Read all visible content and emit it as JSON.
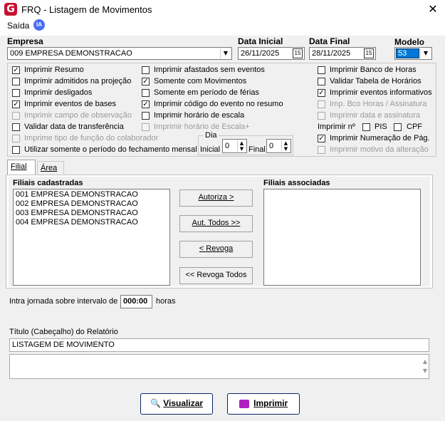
{
  "window": {
    "logo": "G",
    "title": "FRQ - Listagem de Movimentos",
    "close": "✕"
  },
  "menu": {
    "saida": "Saída",
    "ia": "IA"
  },
  "empresa": {
    "label": "Empresa",
    "value": "009 EMPRESA DEMONSTRACAO"
  },
  "data_inicial": {
    "label": "Data Inicial",
    "value": "26/11/2025"
  },
  "data_final": {
    "label": "Data Final",
    "value": "28/11/2025"
  },
  "modelo": {
    "label": "Modelo",
    "value": "53"
  },
  "options": {
    "col1": [
      {
        "label": "Imprimir Resumo",
        "checked": "✓",
        "disabled": false
      },
      {
        "label": "Imprimir admitidos na projeção",
        "checked": "",
        "disabled": false
      },
      {
        "label": "Imprimir desligados",
        "checked": "",
        "disabled": false
      },
      {
        "label": "Imprimir eventos de bases",
        "checked": "✓",
        "disabled": false
      },
      {
        "label": "Imprimir campo de observação",
        "checked": "",
        "disabled": true
      },
      {
        "label": "Validar data de transferência",
        "checked": "",
        "disabled": false
      },
      {
        "label": "Imprime tipo de função do colaborador",
        "checked": "",
        "disabled": true
      },
      {
        "label": "Utilizar somente o período do fechamento mensal",
        "checked": "",
        "disabled": false
      }
    ],
    "col2": [
      {
        "label": "Imprimir afastados sem eventos",
        "checked": "",
        "disabled": false
      },
      {
        "label": "Somente com Movimentos",
        "checked": "✓",
        "disabled": false
      },
      {
        "label": "Somente em período de férias",
        "checked": "",
        "disabled": false
      },
      {
        "label": "Imprimir código do evento no resumo",
        "checked": "✓",
        "disabled": false
      },
      {
        "label": "Imprimir horário de escala",
        "checked": "",
        "disabled": false
      },
      {
        "label": "Imprimir horário de Escala+",
        "checked": "",
        "disabled": true
      }
    ],
    "col3": [
      {
        "label": "Imprimir Banco de Horas",
        "checked": "",
        "disabled": false
      },
      {
        "label": "Validar Tabela de Horários",
        "checked": "",
        "disabled": false
      },
      {
        "label": "Imprimir eventos informativos",
        "checked": "✓",
        "disabled": false
      },
      {
        "label": "Imp. Bco Horas / Assinatura",
        "checked": "",
        "disabled": true
      },
      {
        "label": "Imprimir data e assinatura",
        "checked": "",
        "disabled": true
      }
    ],
    "imprimir_no": {
      "label": "Imprimir nº",
      "pis": "PIS",
      "cpf": "CPF"
    },
    "col3b": [
      {
        "label": "Imprimir Numeração de Pág.",
        "checked": "✓",
        "disabled": false
      },
      {
        "label": "Imprimir motivo da alteração",
        "checked": "",
        "disabled": true
      }
    ]
  },
  "dia": {
    "label": "Dia",
    "inicial_label": "Inicial",
    "inicial_value": "0",
    "final_label": "Final",
    "final_value": "0"
  },
  "tabs": {
    "filial": "Filial",
    "area": "Área"
  },
  "filiais_cadastradas": {
    "label": "Filiais cadastradas",
    "items": [
      "001 EMPRESA DEMONSTRACAO",
      "002 EMPRESA DEMONSTRACAO",
      "003 EMPRESA DEMONSTRACAO",
      "004 EMPRESA DEMONSTRACAO"
    ]
  },
  "filiais_associadas": {
    "label": "Filiais associadas"
  },
  "buttons": {
    "autoriza": "Autoriza >",
    "aut_todos": "Aut. Todos >>",
    "revoga": "< Revoga",
    "revoga_todos": "<< Revoga Todos",
    "visualizar": "Visualizar",
    "imprimir": "Imprimir"
  },
  "intrajornada": {
    "label": "Intra jornada sobre intervalo de",
    "value": "000:00",
    "unit": "horas"
  },
  "titulo": {
    "label": "Título (Cabeçalho) do Relatório",
    "value": "LISTAGEM DE MOVIMENTO"
  },
  "colors": {
    "accent": "#0a246a",
    "logo": "#c8102e",
    "ia": "#4a6cf7"
  }
}
